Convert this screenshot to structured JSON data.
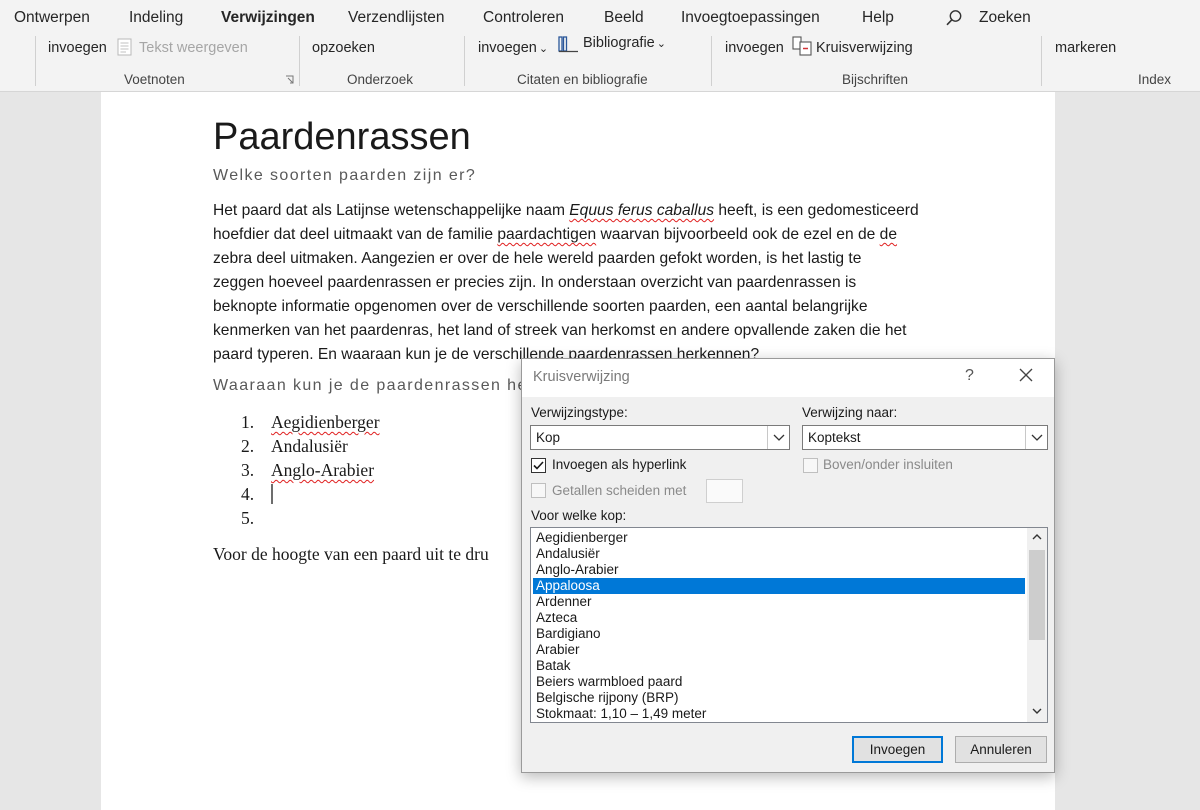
{
  "ribbon": {
    "tabs": [
      "Ontwerpen",
      "Indeling",
      "Verwijzingen",
      "Verzendlijsten",
      "Controleren",
      "Beeld",
      "Invoegtoepassingen",
      "Help"
    ],
    "search_label": "Zoeken",
    "voetnoten": {
      "invoegen": "invoegen",
      "tekst_weergeven": "Tekst weergeven",
      "label": "Voetnoten"
    },
    "onderzoek": {
      "opzoeken": "opzoeken",
      "label": "Onderzoek"
    },
    "citaten": {
      "invoegen": "invoegen",
      "bibliografie": "Bibliografie",
      "label": "Citaten en bibliografie"
    },
    "bijschriften": {
      "invoegen": "invoegen",
      "kruisverwijzing": "Kruisverwijzing",
      "label": "Bijschriften"
    },
    "index": {
      "markeren": "markeren",
      "label": "Index"
    }
  },
  "document": {
    "title": "Paardenrassen",
    "subtitle": "Welke soorten paarden zijn er?",
    "body": [
      "Het paard dat als Latijnse wetenschappelijke naam ",
      "Equus ferus caballus",
      " heeft, is een gedomesticeerd",
      "hoefdier dat deel uitmaakt van de familie ",
      "paardachtigen",
      " waarvan bijvoorbeeld ook de ezel en de ",
      "de",
      "zebra deel uitmaken. Aangezien er over de hele wereld paarden gefokt worden, is het lastig te",
      "zeggen hoeveel paardenrassen er precies zijn. In onderstaan overzicht van paardenrassen is",
      "beknopte informatie opgenomen over de verschillende soorten paarden, een aantal belangrijke",
      "kenmerken van het paardenras, het land of streek van herkomst en andere opvallende zaken die het",
      "paard typeren. En waaraan kun je de verschillende paardenrassen herkennen?"
    ],
    "heading2": "Waaraan kun je de paardenrassen her",
    "list": [
      {
        "num": "1.",
        "text": "Aegidienberger"
      },
      {
        "num": "2.",
        "text": "Andalusiër"
      },
      {
        "num": "3.",
        "text": "Anglo-Arabier"
      },
      {
        "num": "4.",
        "text": ""
      },
      {
        "num": "5.",
        "text": ""
      }
    ],
    "last_line": "Voor de hoogte van een paard uit te dru"
  },
  "dialog": {
    "title": "Kruisverwijzing",
    "help": "?",
    "verwijzingstype_label": "Verwijzingstype:",
    "verwijzingstype_value": "Kop",
    "verwijzing_naar_label": "Verwijzing naar:",
    "verwijzing_naar_value": "Koptekst",
    "hyperlink_label": "Invoegen als hyperlink",
    "hyperlink_checked": true,
    "boven_onder_label": "Boven/onder insluiten",
    "getallen_label": "Getallen scheiden met",
    "voor_welke_label": "Voor welke kop:",
    "items": [
      "Aegidienberger",
      "Andalusiër",
      "Anglo-Arabier",
      "Appaloosa",
      "Ardenner",
      "Azteca",
      "Bardigiano",
      "Arabier",
      "Batak",
      "Beiers warmbloed paard",
      "Belgische rijpony (BRP)",
      "Stokmaat: 1,10 – 1,49 meter"
    ],
    "selected_index": 3,
    "invoegen_button": "Invoegen",
    "annuleren_button": "Annuleren"
  }
}
